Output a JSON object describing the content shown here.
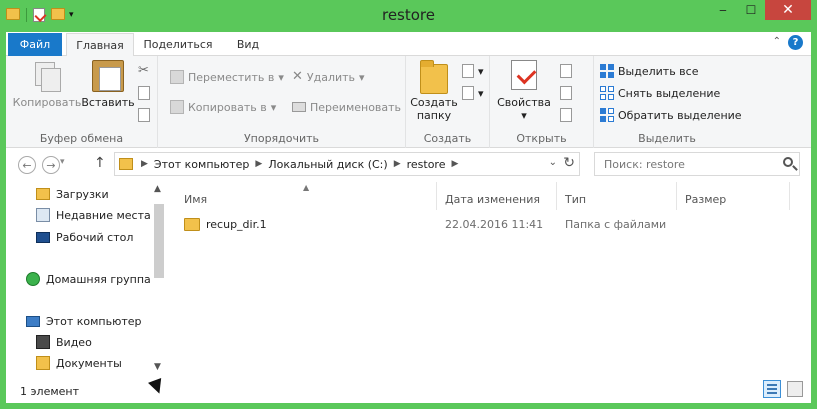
{
  "window": {
    "title": "restore",
    "minimize": "‒",
    "maximize": "☐",
    "close": "✕"
  },
  "tabs": {
    "file": "Файл",
    "home": "Главная",
    "share": "Поделиться",
    "view": "Вид",
    "help": "?"
  },
  "ribbon": {
    "clipboard": {
      "copy": "Копировать",
      "paste": "Вставить",
      "label": "Буфер обмена"
    },
    "organize": {
      "move_to": "Переместить в",
      "copy_to": "Копировать в",
      "delete": "Удалить",
      "rename": "Переименовать",
      "label": "Упорядочить"
    },
    "new": {
      "new_folder": "Создать папку",
      "label": "Создать"
    },
    "open": {
      "properties": "Свойства",
      "label": "Открыть"
    },
    "select": {
      "select_all": "Выделить все",
      "select_none": "Снять выделение",
      "invert": "Обратить выделение",
      "label": "Выделить"
    }
  },
  "address": {
    "crumbs": [
      "Этот компьютер",
      "Локальный диск (C:)",
      "restore"
    ]
  },
  "search": {
    "placeholder": "Поиск: restore"
  },
  "sidebar": {
    "items": [
      {
        "label": "Загрузки",
        "icon": "downloads-folder-icon"
      },
      {
        "label": "Недавние места",
        "icon": "recent-places-icon"
      },
      {
        "label": "Рабочий стол",
        "icon": "desktop-icon"
      },
      {
        "label": "Домашняя группа",
        "icon": "homegroup-icon"
      },
      {
        "label": "Этот компьютер",
        "icon": "computer-icon"
      },
      {
        "label": "Видео",
        "icon": "videos-icon"
      },
      {
        "label": "Документы",
        "icon": "documents-icon"
      }
    ]
  },
  "columns": {
    "name": "Имя",
    "date": "Дата изменения",
    "type": "Тип",
    "size": "Размер"
  },
  "files": [
    {
      "name": "recup_dir.1",
      "date": "22.04.2016 11:41",
      "type": "Папка с файлами",
      "size": ""
    }
  ],
  "status": {
    "count": "1 элемент"
  },
  "colors": {
    "frame": "#5ac85a",
    "file_tab": "#1979ca",
    "close": "#c7463e",
    "folder": "#f2c14b"
  }
}
